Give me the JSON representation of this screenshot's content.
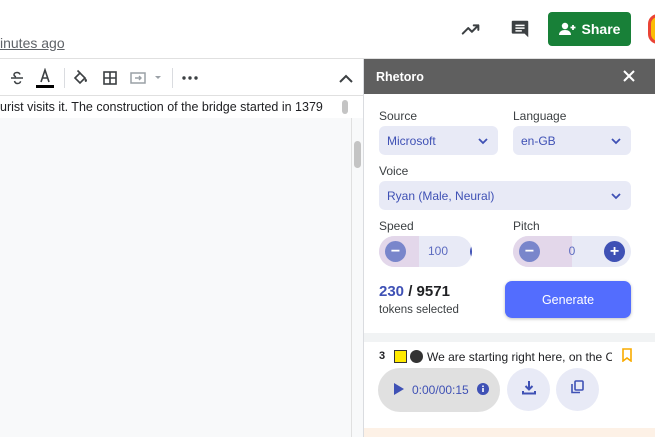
{
  "header": {
    "last_edit": "inutes ago",
    "share_label": "Share",
    "icons": [
      "trending-up-icon",
      "comment-icon",
      "add-person-icon"
    ]
  },
  "doc": {
    "text_line": "urist visits it. The construction of the bridge started in 1379",
    "toolbar_icons": [
      "strikethrough-icon",
      "text-color-icon",
      "fill-color-icon",
      "borders-icon",
      "merge-cells-icon",
      "more-icon",
      "collapse-icon"
    ]
  },
  "sidebar": {
    "title": "Rhetoro",
    "source": {
      "label": "Source",
      "value": "Microsoft"
    },
    "language": {
      "label": "Language",
      "value": "en-GB"
    },
    "voice": {
      "label": "Voice",
      "value": "Ryan (Male, Neural)"
    },
    "speed": {
      "label": "Speed",
      "value": "100"
    },
    "pitch": {
      "label": "Pitch",
      "value": "0"
    },
    "tokens": {
      "selected": "230",
      "separator": " / ",
      "total": "9571",
      "caption": "tokens selected"
    },
    "generate_label": "Generate",
    "history": {
      "index": "3",
      "text": "We are starting right here, on the C...",
      "time": "0:00/00:15"
    }
  },
  "colors": {
    "share_green": "#188038",
    "accent_blue": "#536dfe",
    "header_gray": "#5f5f5f",
    "select_bg": "#e8eaf6"
  }
}
